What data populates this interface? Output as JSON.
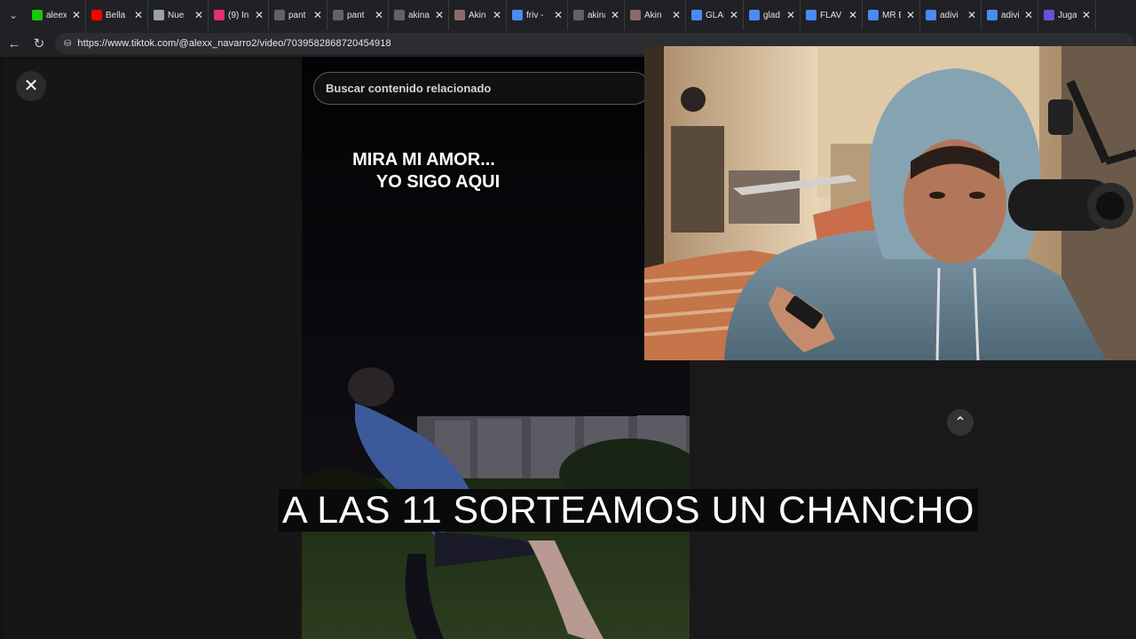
{
  "browser": {
    "tabs": [
      {
        "title": "aleex",
        "color": "#16c60c"
      },
      {
        "title": "Bella",
        "color": "#ff0000"
      },
      {
        "title": "Nue",
        "color": "#9aa0a6"
      },
      {
        "title": "(9) In",
        "color": "#e1306c"
      },
      {
        "title": "pant",
        "color": "#5f6368"
      },
      {
        "title": "pant",
        "color": "#5f6368"
      },
      {
        "title": "akina",
        "color": "#5f6368"
      },
      {
        "title": "Akin",
        "color": "#8e6a6a"
      },
      {
        "title": "friv -",
        "color": "#4a8af4"
      },
      {
        "title": "akina",
        "color": "#5f6368"
      },
      {
        "title": "Akin",
        "color": "#8e6a6a"
      },
      {
        "title": "GLAI",
        "color": "#4a8af4"
      },
      {
        "title": "glad",
        "color": "#4a8af4"
      },
      {
        "title": "FLAV",
        "color": "#4a8af4"
      },
      {
        "title": "MR B",
        "color": "#4a8af4"
      },
      {
        "title": "adivi",
        "color": "#4a8af4"
      },
      {
        "title": "adivi",
        "color": "#4a8af4"
      },
      {
        "title": "Juga",
        "color": "#6b4fd8"
      }
    ],
    "url": "https://www.tiktok.com/@alexx_navarro2/video/7039582868720454918"
  },
  "search": {
    "placeholder": "Buscar contenido relacionado"
  },
  "video": {
    "caption_line1": "MIRA MI AMOR...",
    "caption_line2": "YO SIGO AQUI"
  },
  "stream_overlay": {
    "subtitle": "A LAS 11 SORTEAMOS UN CHANCHO"
  }
}
